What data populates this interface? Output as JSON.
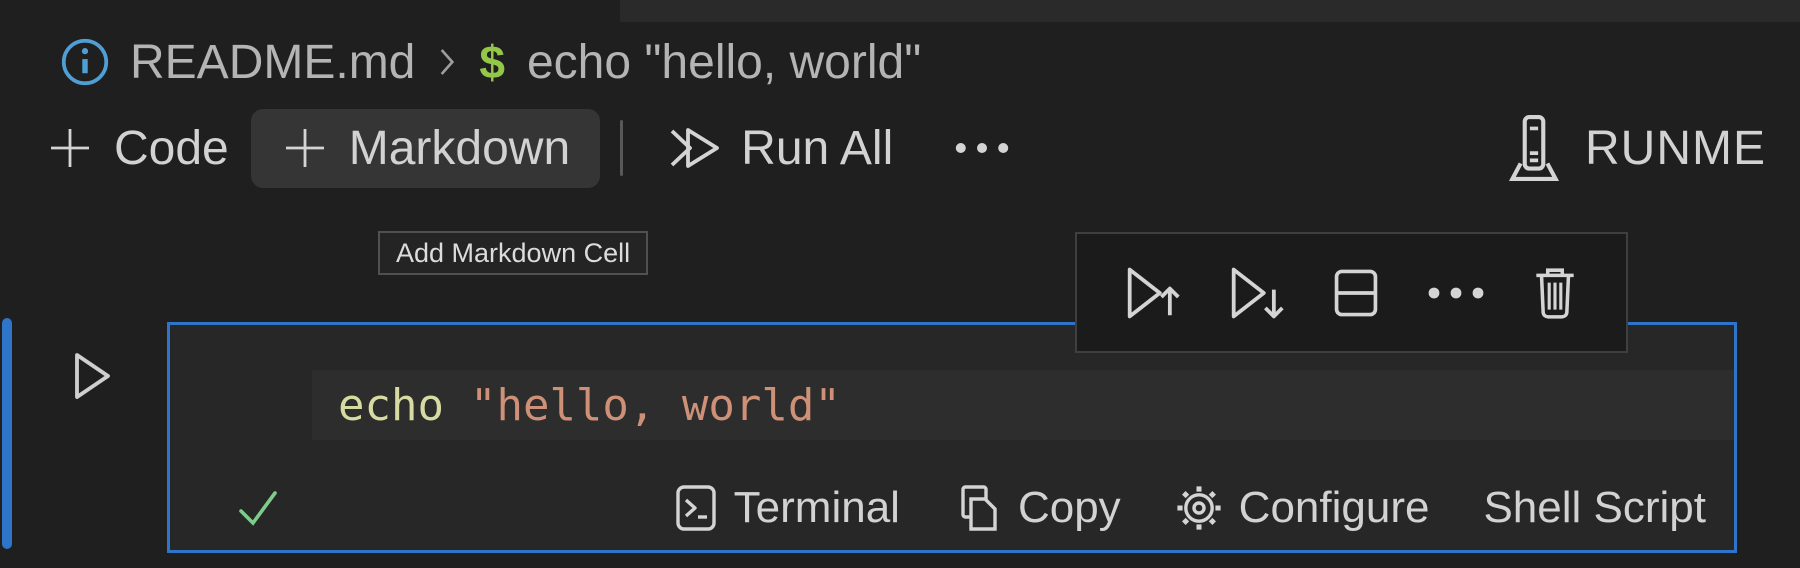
{
  "colors": {
    "accent-blue": "#2e74c8",
    "info-blue": "#4f9fd4",
    "prompt-green": "#94c748",
    "check-green": "#7ecb8c",
    "code-command": "#d7dba2",
    "code-string": "#ce9178"
  },
  "breadcrumb": {
    "file": "README.md",
    "prompt": "$",
    "command": "echo \"hello, world\""
  },
  "toolbar": {
    "code_label": "Code",
    "markdown_label": "Markdown",
    "run_all_label": "Run All",
    "runme_label": "RUNME"
  },
  "tooltip": {
    "text": "Add Markdown Cell"
  },
  "cell": {
    "code": {
      "command": "echo",
      "argument": "\"hello, world\""
    },
    "status": {
      "terminal_label": "Terminal",
      "copy_label": "Copy",
      "configure_label": "Configure",
      "language_label": "Shell Script"
    }
  }
}
